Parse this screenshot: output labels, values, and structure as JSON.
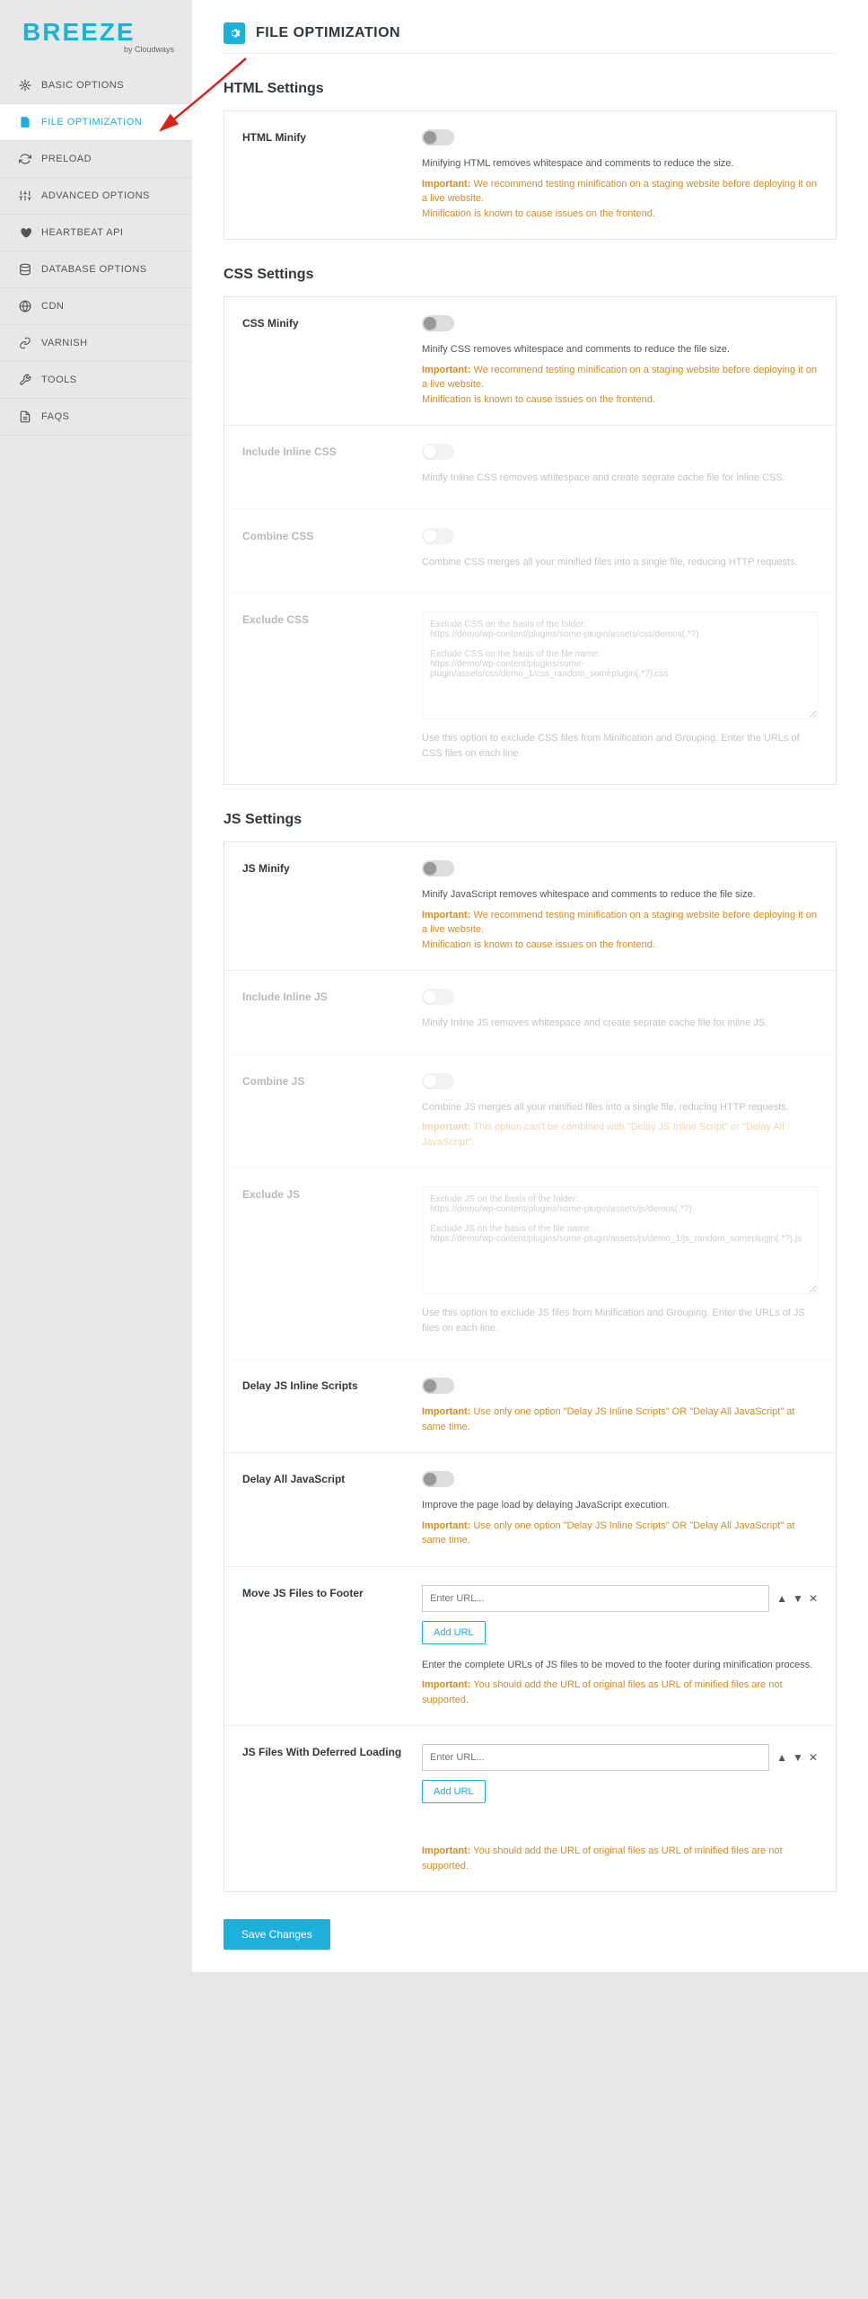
{
  "logo": {
    "text": "BREEZE",
    "subtitle": "by Cloudways"
  },
  "nav": [
    {
      "label": "BASIC OPTIONS",
      "icon": "sliders"
    },
    {
      "label": "FILE OPTIMIZATION",
      "icon": "file",
      "active": true
    },
    {
      "label": "PRELOAD",
      "icon": "refresh"
    },
    {
      "label": "ADVANCED OPTIONS",
      "icon": "tune"
    },
    {
      "label": "HEARTBEAT API",
      "icon": "heart"
    },
    {
      "label": "DATABASE OPTIONS",
      "icon": "database"
    },
    {
      "label": "CDN",
      "icon": "globe"
    },
    {
      "label": "VARNISH",
      "icon": "link"
    },
    {
      "label": "TOOLS",
      "icon": "wrench"
    },
    {
      "label": "FAQS",
      "icon": "doc"
    }
  ],
  "page_title": "FILE OPTIMIZATION",
  "sections": {
    "html": {
      "title": "HTML Settings",
      "minify": {
        "label": "HTML Minify",
        "desc": "Minifying HTML removes whitespace and comments to reduce the size.",
        "warn_label": "Important:",
        "warn": "We recommend testing minification on a staging website before deploying it on a live website.",
        "warn2": "Minification is known to cause issues on the frontend."
      }
    },
    "css": {
      "title": "CSS Settings",
      "minify": {
        "label": "CSS Minify",
        "desc": "Minify CSS removes whitespace and comments to reduce the file size.",
        "warn_label": "Important:",
        "warn": "We recommend testing minification on a staging website before deploying it on a live website.",
        "warn2": "Minification is known to cause issues on the frontend."
      },
      "inline": {
        "label": "Include Inline CSS",
        "desc": "Minify Inline CSS removes whitespace and create seprate cache file for inline CSS."
      },
      "combine": {
        "label": "Combine CSS",
        "desc": "Combine CSS merges all your minified files into a single file, reducing HTTP requests."
      },
      "exclude": {
        "label": "Exclude CSS",
        "placeholder": "Exclude CSS on the basis of the folder:\nhttps://demo/wp-content/plugins/some-plugin/assets/css/demos(.*?)\n\nExclude CSS on the basis of the file name:\nhttps://demo/wp-content/plugins/some-plugin/assets/css/demo_1/css_random_someplugin(.*?).css",
        "desc": "Use this option to exclude CSS files from Minification and Grouping. Enter the URLs of CSS files on each line."
      }
    },
    "js": {
      "title": "JS Settings",
      "minify": {
        "label": "JS Minify",
        "desc": "Minify JavaScript removes whitespace and comments to reduce the file size.",
        "warn_label": "Important:",
        "warn": "We recommend testing minification on a staging website before deploying it on a live website.",
        "warn2": "Minification is known to cause issues on the frontend."
      },
      "inline": {
        "label": "Include Inline JS",
        "desc": "Minify Inline JS removes whitespace and create seprate cache file for inline JS."
      },
      "combine": {
        "label": "Combine JS",
        "desc": "Combine JS merges all your minified files into a single file, reducing HTTP requests.",
        "warn_label": "Important:",
        "warn": "This option can't be combined with \"Delay JS Inline Script\" or \"Delay All JavaScript\"."
      },
      "exclude": {
        "label": "Exclude JS",
        "placeholder": "Exclude JS on the basis of the folder:\nhttps://demo/wp-content/plugins/some-plugin/assets/js/demos(.*?)\n\nExclude JS on the basis of the file name:\nhttps://demo/wp-content/plugins/some-plugin/assets/js/demo_1/js_random_someplugin(.*?).js",
        "desc": "Use this option to exclude JS files from Minification and Grouping. Enter the URLs of JS files on each line."
      },
      "delay_inline": {
        "label": "Delay JS Inline Scripts",
        "warn_label": "Important:",
        "warn": "Use only one option \"Delay JS Inline Scripts\" OR \"Delay All JavaScript\" at same time."
      },
      "delay_all": {
        "label": "Delay All JavaScript",
        "desc": "Improve the page load by delaying JavaScript execution.",
        "warn_label": "Important:",
        "warn": "Use only one option \"Delay JS Inline Scripts\" OR \"Delay All JavaScript\" at same time."
      },
      "move_footer": {
        "label": "Move JS Files to Footer",
        "placeholder": "Enter URL...",
        "add_btn": "Add URL",
        "desc": "Enter the complete URLs of JS files to be moved to the footer during minification process.",
        "warn_label": "Important:",
        "warn": "You should add the URL of original files as URL of minified files are not supported."
      },
      "deferred": {
        "label": "JS Files With Deferred Loading",
        "placeholder": "Enter URL...",
        "add_btn": "Add URL",
        "warn_label": "Important:",
        "warn": "You should add the URL of original files as URL of minified files are not supported."
      }
    }
  },
  "save_button": "Save Changes"
}
